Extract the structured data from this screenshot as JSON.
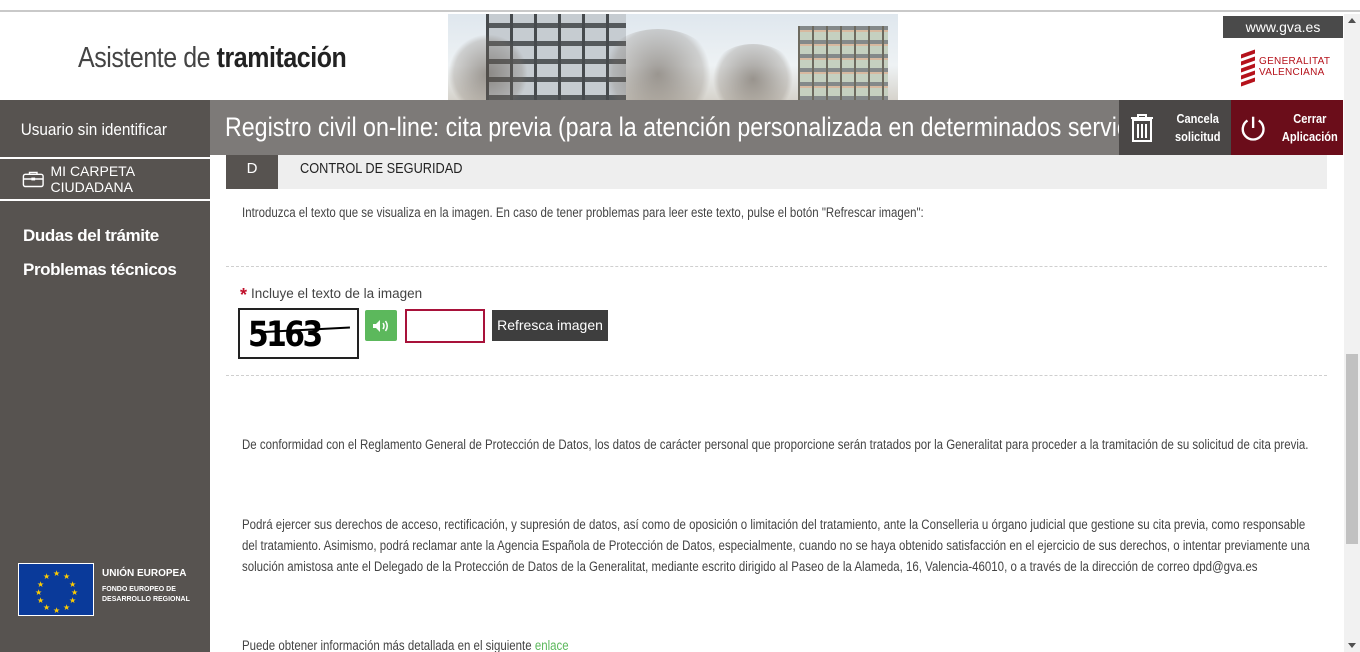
{
  "header": {
    "brand_prefix": "Asistente de",
    "brand_bold": "tramitación",
    "site_link": "www.gva.es",
    "logo_line1": "GENERALITAT",
    "logo_line2": "VALENCIANA"
  },
  "sidebar": {
    "user": "Usuario sin identificar",
    "carpeta": "MI CARPETA CIUDADANA",
    "links": [
      "Dudas del trámite",
      "Problemas técnicos"
    ],
    "eu_title": "UNIÓN EUROPEA",
    "eu_sub1": "FONDO EUROPEO DE",
    "eu_sub2": "DESARROLLO REGIONAL"
  },
  "titlebar": {
    "title": "Registro civil on-line: cita previa (para la atención personalizada en determinados servicios)",
    "cancel_line1": "Cancela",
    "cancel_line2": "solicitud",
    "close_line1": "Cerrar",
    "close_line2": "Aplicación"
  },
  "section": {
    "letter": "D",
    "title": "CONTROL DE SEGURIDAD",
    "intro": "Introduzca el texto que se visualiza en la imagen. En caso de tener problemas para leer este texto, pulse el botón \"Refrescar imagen\":",
    "required_mark": "*",
    "field_label": "Incluye el texto de la imagen",
    "captcha_text": "5163",
    "captcha_value": "",
    "refresh_label": "Refresca imagen"
  },
  "legal": {
    "p1": "De conformidad con el Reglamento General de Protección de Datos, los datos de carácter personal que proporcione serán tratados por la Generalitat para proceder a la tramitación de su solicitud de cita previa.",
    "p2": "Podrá ejercer sus derechos de acceso, rectificación, y supresión de datos, así como de oposición o limitación del tratamiento, ante la Conselleria u órgano judicial que gestione su cita previa, como responsable del tratamiento. Asimismo, podrá reclamar ante la Agencia Española de Protección de Datos, especialmente, cuando no se haya obtenido satisfacción en el ejercicio de sus derechos, o intentar previamente una solución amistosa ante el Delegado de la Protección de Datos de la Generalitat, mediante escrito dirigido al Paseo de la Alameda, 16, Valencia-46010, o a través de la dirección de correo dpd@gva.es",
    "p3": "Puede obtener información más detallada en el siguiente",
    "link": "enlace"
  },
  "colors": {
    "sidebar": "#575350",
    "titlebar": "#7d7a78",
    "close_button": "#6b0d1a",
    "audio_button": "#5cb85c",
    "input_border": "#a8123a"
  }
}
